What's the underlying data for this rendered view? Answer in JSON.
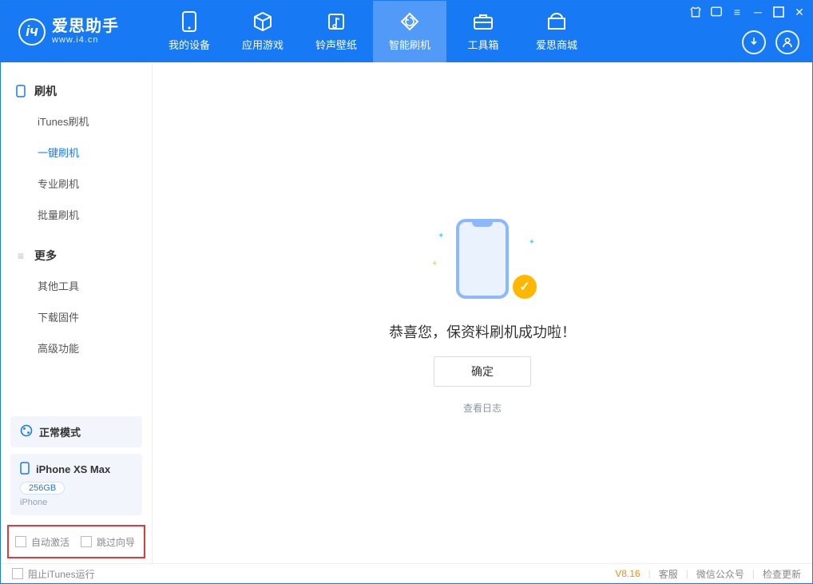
{
  "app": {
    "name": "爱思助手",
    "url": "www.i4.cn"
  },
  "window_controls": {
    "skin": "skin",
    "shop": "shop",
    "menu": "menu",
    "min": "min",
    "max": "max",
    "close": "close"
  },
  "header_circles": {
    "download": "download",
    "user": "user"
  },
  "tabs": [
    {
      "label": "我的设备",
      "icon": "device"
    },
    {
      "label": "应用游戏",
      "icon": "cube"
    },
    {
      "label": "铃声壁纸",
      "icon": "music"
    },
    {
      "label": "智能刷机",
      "icon": "reflash",
      "active": true
    },
    {
      "label": "工具箱",
      "icon": "toolbox"
    },
    {
      "label": "爱思商城",
      "icon": "store"
    }
  ],
  "sidebar": {
    "section1_title": "刷机",
    "section1_items": [
      "iTunes刷机",
      "一键刷机",
      "专业刷机",
      "批量刷机"
    ],
    "section1_active_index": 1,
    "section2_title": "更多",
    "section2_items": [
      "其他工具",
      "下载固件",
      "高级功能"
    ]
  },
  "device_status": {
    "mode_label": "正常模式",
    "device_name": "iPhone XS Max",
    "storage": "256GB",
    "device_type": "iPhone"
  },
  "highlight_checks": {
    "auto_activate": "自动激活",
    "skip_wizard": "跳过向导"
  },
  "main": {
    "success_message": "恭喜您，保资料刷机成功啦！",
    "ok_button": "确定",
    "view_log": "查看日志"
  },
  "footer": {
    "block_itunes": "阻止iTunes运行",
    "version": "V8.16",
    "customer_service": "客服",
    "wechat": "微信公众号",
    "check_update": "检查更新"
  }
}
